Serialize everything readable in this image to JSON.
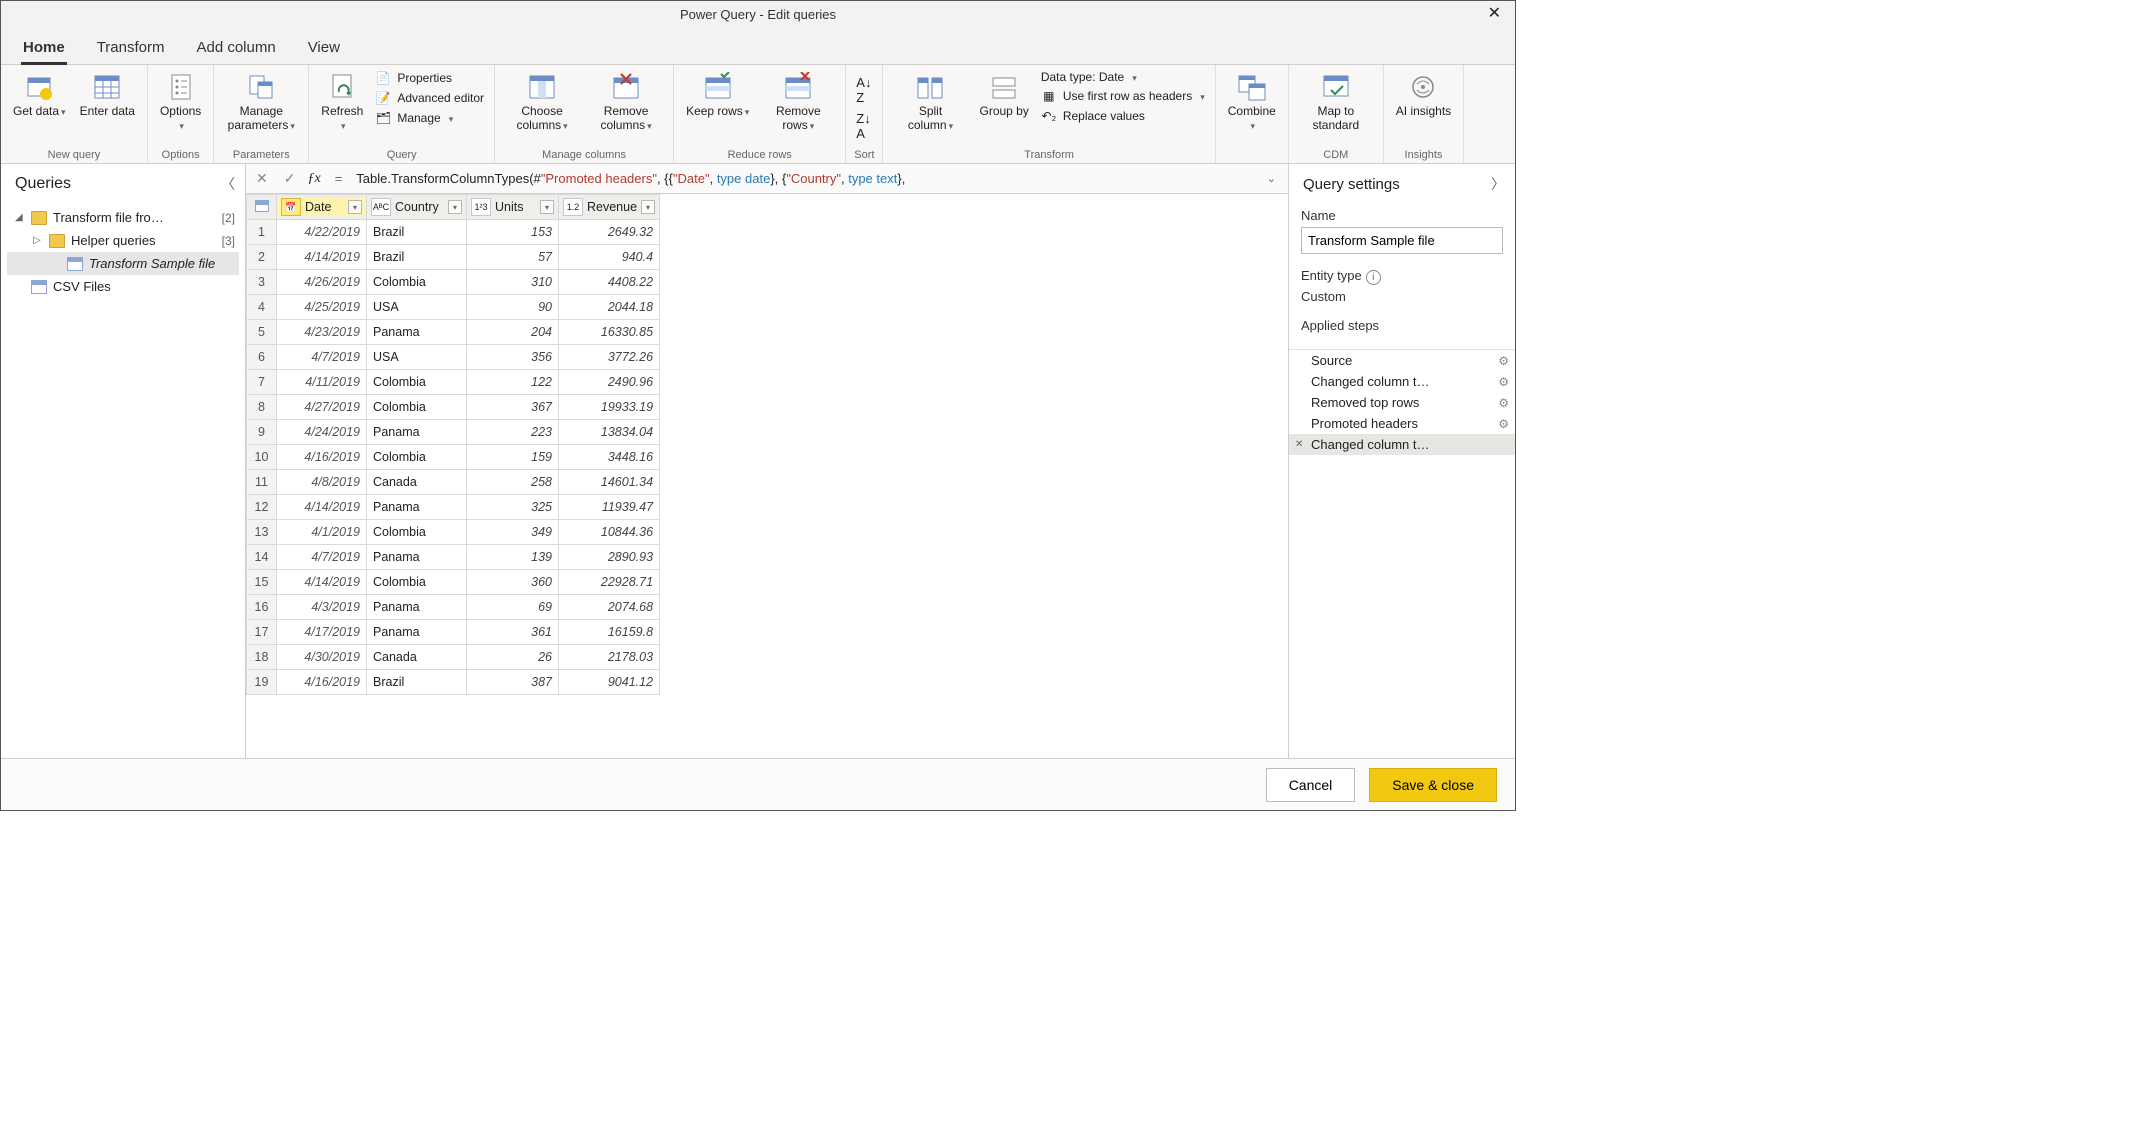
{
  "title": "Power Query - Edit queries",
  "tabs": [
    "Home",
    "Transform",
    "Add column",
    "View"
  ],
  "ribbon": {
    "get_data": "Get data",
    "enter_data": "Enter data",
    "options": "Options",
    "manage_params": "Manage parameters",
    "refresh": "Refresh",
    "properties": "Properties",
    "advanced_editor": "Advanced editor",
    "manage": "Manage",
    "choose_cols": "Choose columns",
    "remove_cols": "Remove columns",
    "keep_rows": "Keep rows",
    "remove_rows": "Remove rows",
    "split_col": "Split column",
    "group_by": "Group by",
    "data_type": "Data type: Date",
    "first_row": "Use first row as headers",
    "replace": "Replace values",
    "combine": "Combine",
    "map_std": "Map to standard",
    "ai": "AI insights",
    "groups": {
      "new_query": "New query",
      "options": "Options",
      "parameters": "Parameters",
      "query": "Query",
      "manage_cols": "Manage columns",
      "reduce_rows": "Reduce rows",
      "sort": "Sort",
      "transform": "Transform",
      "cdm": "CDM",
      "insights": "Insights"
    }
  },
  "queries_panel": {
    "title": "Queries",
    "items": [
      {
        "name": "Transform file fro…",
        "count": "[2]",
        "type": "folder",
        "expanded": true
      },
      {
        "name": "Helper queries",
        "count": "[3]",
        "type": "folder",
        "expanded": false,
        "indent": 1
      },
      {
        "name": "Transform Sample file",
        "type": "table",
        "indent": 2,
        "selected": true
      },
      {
        "name": "CSV Files",
        "type": "table",
        "indent": 0
      }
    ]
  },
  "formula": {
    "prefix": "Table.TransformColumnTypes(#",
    "s1": "\"Promoted headers\"",
    "mid1": ", {{",
    "s2": "\"Date\"",
    "mid2": ", ",
    "kw1": "type date",
    "mid3": "}, {",
    "s3": "\"Country\"",
    "mid4": ", ",
    "kw2": "type text",
    "end": "},"
  },
  "columns": [
    {
      "name": "Date",
      "type": "date",
      "selected": true
    },
    {
      "name": "Country",
      "type": "text"
    },
    {
      "name": "Units",
      "type": "int"
    },
    {
      "name": "Revenue",
      "type": "decimal"
    }
  ],
  "rows": [
    {
      "n": 1,
      "date": "4/22/2019",
      "country": "Brazil",
      "units": "153",
      "rev": "2649.32"
    },
    {
      "n": 2,
      "date": "4/14/2019",
      "country": "Brazil",
      "units": "57",
      "rev": "940.4"
    },
    {
      "n": 3,
      "date": "4/26/2019",
      "country": "Colombia",
      "units": "310",
      "rev": "4408.22"
    },
    {
      "n": 4,
      "date": "4/25/2019",
      "country": "USA",
      "units": "90",
      "rev": "2044.18"
    },
    {
      "n": 5,
      "date": "4/23/2019",
      "country": "Panama",
      "units": "204",
      "rev": "16330.85"
    },
    {
      "n": 6,
      "date": "4/7/2019",
      "country": "USA",
      "units": "356",
      "rev": "3772.26"
    },
    {
      "n": 7,
      "date": "4/11/2019",
      "country": "Colombia",
      "units": "122",
      "rev": "2490.96"
    },
    {
      "n": 8,
      "date": "4/27/2019",
      "country": "Colombia",
      "units": "367",
      "rev": "19933.19"
    },
    {
      "n": 9,
      "date": "4/24/2019",
      "country": "Panama",
      "units": "223",
      "rev": "13834.04"
    },
    {
      "n": 10,
      "date": "4/16/2019",
      "country": "Colombia",
      "units": "159",
      "rev": "3448.16"
    },
    {
      "n": 11,
      "date": "4/8/2019",
      "country": "Canada",
      "units": "258",
      "rev": "14601.34"
    },
    {
      "n": 12,
      "date": "4/14/2019",
      "country": "Panama",
      "units": "325",
      "rev": "11939.47"
    },
    {
      "n": 13,
      "date": "4/1/2019",
      "country": "Colombia",
      "units": "349",
      "rev": "10844.36"
    },
    {
      "n": 14,
      "date": "4/7/2019",
      "country": "Panama",
      "units": "139",
      "rev": "2890.93"
    },
    {
      "n": 15,
      "date": "4/14/2019",
      "country": "Colombia",
      "units": "360",
      "rev": "22928.71"
    },
    {
      "n": 16,
      "date": "4/3/2019",
      "country": "Panama",
      "units": "69",
      "rev": "2074.68"
    },
    {
      "n": 17,
      "date": "4/17/2019",
      "country": "Panama",
      "units": "361",
      "rev": "16159.8"
    },
    {
      "n": 18,
      "date": "4/30/2019",
      "country": "Canada",
      "units": "26",
      "rev": "2178.03"
    },
    {
      "n": 19,
      "date": "4/16/2019",
      "country": "Brazil",
      "units": "387",
      "rev": "9041.12"
    }
  ],
  "settings": {
    "title": "Query settings",
    "name_label": "Name",
    "name_value": "Transform Sample file",
    "entity_label": "Entity type",
    "entity_value": "Custom",
    "steps_label": "Applied steps",
    "steps": [
      {
        "name": "Source",
        "gear": true
      },
      {
        "name": "Changed column t…",
        "gear": true
      },
      {
        "name": "Removed top rows",
        "gear": true
      },
      {
        "name": "Promoted headers",
        "gear": true
      },
      {
        "name": "Changed column t…",
        "gear": false,
        "selected": true
      }
    ]
  },
  "footer": {
    "cancel": "Cancel",
    "save": "Save & close"
  }
}
